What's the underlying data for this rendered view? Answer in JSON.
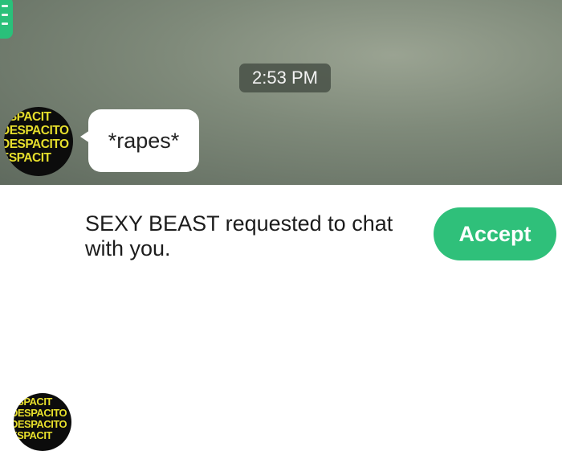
{
  "chat": {
    "timestamp": "2:53 PM",
    "message": "*rapes*",
    "avatar_text": [
      "ESPACIT",
      "DESPACITO",
      "DESPACITO",
      "ESPACIT"
    ]
  },
  "request": {
    "text": "SEXY BEAST requested to chat with you.",
    "accept_label": "Accept",
    "avatar_text": [
      "ESPACIT",
      "DESPACITO",
      "DESPACITO",
      "ESPACIT"
    ]
  },
  "colors": {
    "accent_green": "#2fc07a",
    "avatar_text": "#e7df2c"
  },
  "icons": {
    "menu": "hamburger-menu-icon"
  }
}
